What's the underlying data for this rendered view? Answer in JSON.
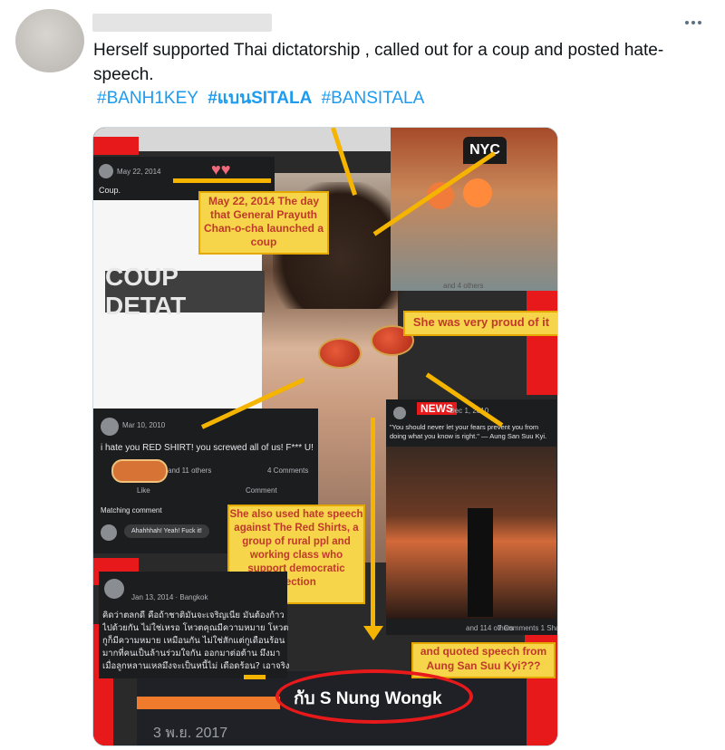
{
  "tweet": {
    "text": "Herself supported Thai dictatorship , called out for a coup and posted hate-speech.",
    "hashtags": [
      "#BANH1KEY",
      "#แบนSITALA",
      "#BANSITALA"
    ],
    "more_icon": "more-horizontal-icon"
  },
  "media": {
    "post1": {
      "date": "May 22, 2014",
      "text": "Coup."
    },
    "note1": "May 22, 2014 The day that General Prayuth Chan-o-cha launched a coup",
    "coup_label": "COUP DETAT",
    "note2": "She was very proud of it",
    "photo_cap": {
      "hat": "NYC",
      "others": "and 4 others"
    },
    "post2": {
      "date": "Mar 10, 2010",
      "text": "i hate you RED SHIRT! you screwed all of us! F*** U!",
      "reactions": "and 11 others",
      "comments": "4 Comments",
      "like": "Like",
      "comment": "Comment",
      "matching": "Matching comment",
      "reply": "Ahahhhah! Yeah! Fuck it!"
    },
    "note3": "She also used hate speech against  The Red Shirts, a group of rural ppl and working class who support democratic election",
    "post3": {
      "badge": "NEWS",
      "date": "Dec 1, 2010",
      "quote": "\"You should never let your fears prevent you from doing what you know is right.\" — Aung San Suu Kyi.",
      "reactions": "and 114 others",
      "comments": "7 Comments",
      "shares": "1 Share"
    },
    "post4": {
      "date": "Jan 13, 2014 · Bangkok",
      "text": "คิดว่าตลกดี คือถ้าชาติมันจะเจริญเนี่ย มันต้องก้าวไปด้วยกัน ไม่ใช่เหรอ โหวตคุณมีความหมาย โหวตกูก็มีความหมาย เหมือนกัน ไม่ใช่สักแต่กูเดือนร้อนมากที่คนเป็นล้านร่วมใจกัน ออกมาต่อต้าน มึงมาเมื่อลูกหลานเหลมึงจะเป็นหนี้ไม่ เดือดร้อน? เอาจริง ถ้าประเทศจะเจริญไม่ได้ขึ้นอยู่กับแค่เสียง โหวตนะ อยู่ที่สมองมึงด้วย ดึนนนนนนน -"
    },
    "note4": "and quoted speech from Aung San Suu Kyi???",
    "caption": "กับ S Nung Wongk",
    "date": "3 พ.ย. 2017",
    "colors": {
      "red": "#e8191b",
      "yellow": "#f6d54a",
      "arrow": "#f4b400",
      "note_text": "#c0392b"
    }
  }
}
